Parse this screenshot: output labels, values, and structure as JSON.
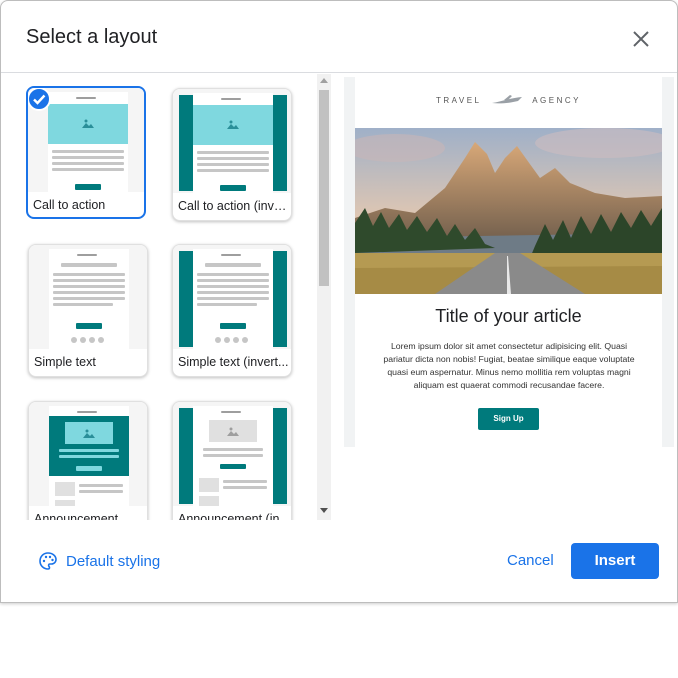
{
  "dialog": {
    "title": "Select a layout"
  },
  "layouts": [
    {
      "label": "Call to action",
      "selected": true
    },
    {
      "label": "Call to action (inve..."
    },
    {
      "label": "Simple text"
    },
    {
      "label": "Simple text (invert..."
    },
    {
      "label": "Announcement"
    },
    {
      "label": "Announcement (in..."
    }
  ],
  "preview": {
    "logo_text": "TRAVEL",
    "logo_text2": "AGENCY",
    "title": "Title of your article",
    "body": "Lorem ipsum dolor sit amet consectetur adipisicing elit. Quasi pariatur dicta non nobis! Fugiat, beatae similique eaque voluptate quasi eum aspernatur. Minus nemo mollitia rem voluptas magni aliquam est quaerat commodi recusandae facere.",
    "button": "Sign Up"
  },
  "footer": {
    "default_styling": "Default styling",
    "cancel": "Cancel",
    "insert": "Insert"
  },
  "colors": {
    "accent": "#1a73e8",
    "teal": "#007a7c"
  }
}
